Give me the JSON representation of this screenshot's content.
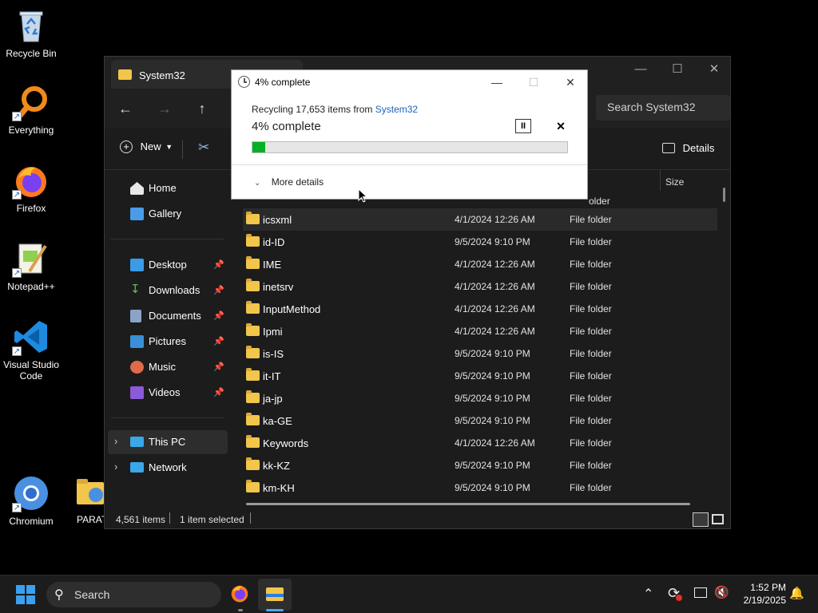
{
  "desktop": {
    "icons": [
      {
        "label": "Recycle Bin"
      },
      {
        "label": "Everything"
      },
      {
        "label": "Firefox"
      },
      {
        "label": "Notepad++"
      },
      {
        "label": "Visual Studio Code"
      },
      {
        "label": "Chromium"
      },
      {
        "label": "PARAT"
      }
    ]
  },
  "explorer": {
    "title": "System32",
    "search_placeholder": "Search System32",
    "cmd": {
      "new_label": "New",
      "details_label": "Details"
    },
    "column_size": "Size",
    "partial_type": "older",
    "sidebar": {
      "home": "Home",
      "gallery": "Gallery",
      "desktop": "Desktop",
      "downloads": "Downloads",
      "documents": "Documents",
      "pictures": "Pictures",
      "music": "Music",
      "videos": "Videos",
      "thispc": "This PC",
      "network": "Network"
    },
    "rows": [
      {
        "name": "icsxml",
        "date": "4/1/2024 12:26 AM",
        "type": "File folder"
      },
      {
        "name": "id-ID",
        "date": "9/5/2024 9:10 PM",
        "type": "File folder"
      },
      {
        "name": "IME",
        "date": "4/1/2024 12:26 AM",
        "type": "File folder"
      },
      {
        "name": "inetsrv",
        "date": "4/1/2024 12:26 AM",
        "type": "File folder"
      },
      {
        "name": "InputMethod",
        "date": "4/1/2024 12:26 AM",
        "type": "File folder"
      },
      {
        "name": "Ipmi",
        "date": "4/1/2024 12:26 AM",
        "type": "File folder"
      },
      {
        "name": "is-IS",
        "date": "9/5/2024 9:10 PM",
        "type": "File folder"
      },
      {
        "name": "it-IT",
        "date": "9/5/2024 9:10 PM",
        "type": "File folder"
      },
      {
        "name": "ja-jp",
        "date": "9/5/2024 9:10 PM",
        "type": "File folder"
      },
      {
        "name": "ka-GE",
        "date": "9/5/2024 9:10 PM",
        "type": "File folder"
      },
      {
        "name": "Keywords",
        "date": "4/1/2024 12:26 AM",
        "type": "File folder"
      },
      {
        "name": "kk-KZ",
        "date": "9/5/2024 9:10 PM",
        "type": "File folder"
      },
      {
        "name": "km-KH",
        "date": "9/5/2024 9:10 PM",
        "type": "File folder"
      }
    ],
    "status": {
      "count": "4,561 items",
      "selected": "1 item selected"
    }
  },
  "dialog": {
    "title": "4% complete",
    "line1_prefix": "Recycling 17,653 items from ",
    "line1_link": "System32",
    "line2": "4% complete",
    "progress": 0.04,
    "more_details": "More details",
    "colors": {
      "progress": "#06b025",
      "link": "#1a63b8"
    }
  },
  "taskbar": {
    "search_label": "Search",
    "time": "1:52 PM",
    "date": "2/19/2025"
  }
}
